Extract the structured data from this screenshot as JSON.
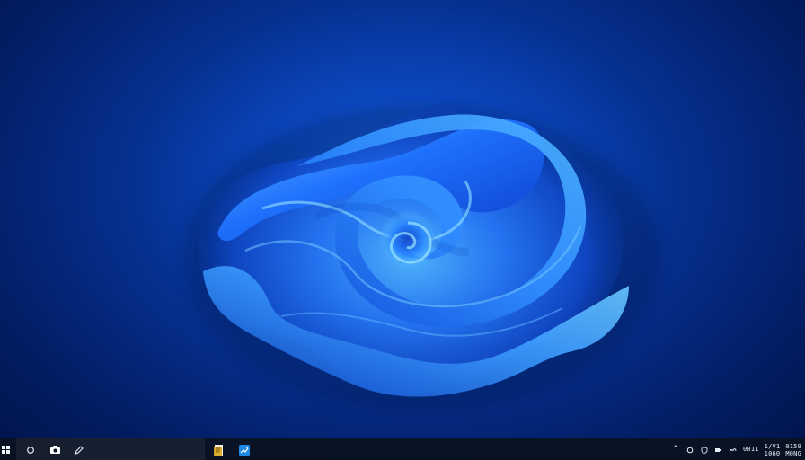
{
  "desktop": {
    "wallpaper": "blue-swirl-bloom",
    "background_colors": [
      "#021d63",
      "#0b48c0",
      "#1e6ce6",
      "#46a6ff"
    ]
  },
  "taskbar": {
    "start_icon": "windows-logo-icon",
    "search_icon": "search-circle-icon",
    "task_view_icon": "camera-icon",
    "pen_icon": "pen-icon",
    "pinned_apps": [
      {
        "name": "notes-app-icon"
      },
      {
        "name": "photos-app-icon"
      }
    ],
    "tray": {
      "chevron": "^",
      "text_1": "0011",
      "clock_line_1": "1/V1",
      "clock_line_2": "1060",
      "date_line_1": "0159",
      "date_line_2": "M0NG"
    }
  }
}
